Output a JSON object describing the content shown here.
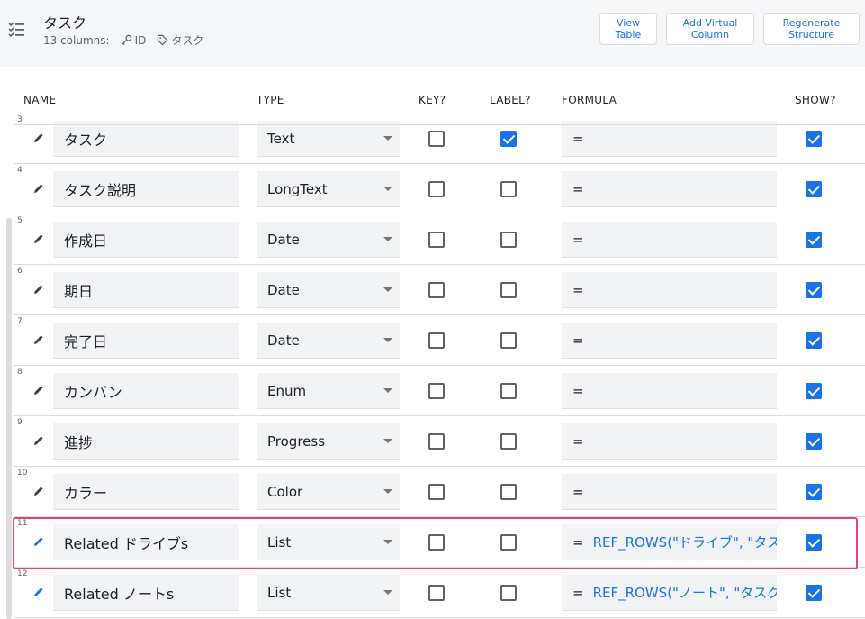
{
  "table": {
    "title": "タスク",
    "columns_count": "13 columns:",
    "key_label": "ID",
    "label_label": "タスク"
  },
  "buttons": {
    "view_table": "View Table",
    "add_virtual_column": "Add Virtual Column",
    "regenerate_structure": "Regenerate Structure"
  },
  "headers": {
    "name": "NAME",
    "type": "TYPE",
    "key": "KEY?",
    "label": "LABEL?",
    "formula": "FORMULA",
    "show": "SHOW?"
  },
  "rows": [
    {
      "num": "3",
      "name": "タスク",
      "type": "Text",
      "key": false,
      "label": true,
      "formula_eq": "=",
      "formula": "",
      "show": true
    },
    {
      "num": "4",
      "name": "タスク説明",
      "type": "LongText",
      "key": false,
      "label": false,
      "formula_eq": "=",
      "formula": "",
      "show": true
    },
    {
      "num": "5",
      "name": "作成日",
      "type": "Date",
      "key": false,
      "label": false,
      "formula_eq": "=",
      "formula": "",
      "show": true
    },
    {
      "num": "6",
      "name": "期日",
      "type": "Date",
      "key": false,
      "label": false,
      "formula_eq": "=",
      "formula": "",
      "show": true
    },
    {
      "num": "7",
      "name": "完了日",
      "type": "Date",
      "key": false,
      "label": false,
      "formula_eq": "=",
      "formula": "",
      "show": true
    },
    {
      "num": "8",
      "name": "カンバン",
      "type": "Enum",
      "key": false,
      "label": false,
      "formula_eq": "=",
      "formula": "",
      "show": true
    },
    {
      "num": "9",
      "name": "進捗",
      "type": "Progress",
      "key": false,
      "label": false,
      "formula_eq": "=",
      "formula": "",
      "show": true
    },
    {
      "num": "10",
      "name": "カラー",
      "type": "Color",
      "key": false,
      "label": false,
      "formula_eq": "=",
      "formula": "",
      "show": true
    },
    {
      "num": "11",
      "name": "Related ドライブs",
      "type": "List",
      "key": false,
      "label": false,
      "formula_eq": "=",
      "formula": "REF_ROWS(\"ドライブ\", \"タスク\")",
      "show": true,
      "virtual": true
    },
    {
      "num": "12",
      "name": "Related ノートs",
      "type": "List",
      "key": false,
      "label": false,
      "formula_eq": "=",
      "formula": "REF_ROWS(\"ノート\", \"タスク\")",
      "show": true,
      "virtual": true
    }
  ],
  "colors": {
    "accent": "#1a73e8",
    "highlight": "#e0457b",
    "header_bg": "#f5f6f8",
    "field_bg": "#f1f3f4"
  }
}
